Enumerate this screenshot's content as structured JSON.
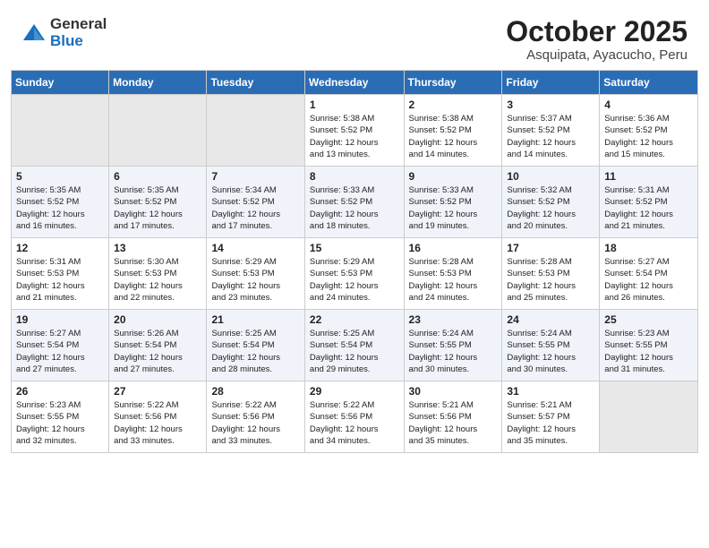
{
  "header": {
    "logo_general": "General",
    "logo_blue": "Blue",
    "month": "October 2025",
    "location": "Asquipata, Ayacucho, Peru"
  },
  "weekdays": [
    "Sunday",
    "Monday",
    "Tuesday",
    "Wednesday",
    "Thursday",
    "Friday",
    "Saturday"
  ],
  "weeks": [
    [
      {
        "day": "",
        "info": ""
      },
      {
        "day": "",
        "info": ""
      },
      {
        "day": "",
        "info": ""
      },
      {
        "day": "1",
        "info": "Sunrise: 5:38 AM\nSunset: 5:52 PM\nDaylight: 12 hours\nand 13 minutes."
      },
      {
        "day": "2",
        "info": "Sunrise: 5:38 AM\nSunset: 5:52 PM\nDaylight: 12 hours\nand 14 minutes."
      },
      {
        "day": "3",
        "info": "Sunrise: 5:37 AM\nSunset: 5:52 PM\nDaylight: 12 hours\nand 14 minutes."
      },
      {
        "day": "4",
        "info": "Sunrise: 5:36 AM\nSunset: 5:52 PM\nDaylight: 12 hours\nand 15 minutes."
      }
    ],
    [
      {
        "day": "5",
        "info": "Sunrise: 5:35 AM\nSunset: 5:52 PM\nDaylight: 12 hours\nand 16 minutes."
      },
      {
        "day": "6",
        "info": "Sunrise: 5:35 AM\nSunset: 5:52 PM\nDaylight: 12 hours\nand 17 minutes."
      },
      {
        "day": "7",
        "info": "Sunrise: 5:34 AM\nSunset: 5:52 PM\nDaylight: 12 hours\nand 17 minutes."
      },
      {
        "day": "8",
        "info": "Sunrise: 5:33 AM\nSunset: 5:52 PM\nDaylight: 12 hours\nand 18 minutes."
      },
      {
        "day": "9",
        "info": "Sunrise: 5:33 AM\nSunset: 5:52 PM\nDaylight: 12 hours\nand 19 minutes."
      },
      {
        "day": "10",
        "info": "Sunrise: 5:32 AM\nSunset: 5:52 PM\nDaylight: 12 hours\nand 20 minutes."
      },
      {
        "day": "11",
        "info": "Sunrise: 5:31 AM\nSunset: 5:52 PM\nDaylight: 12 hours\nand 21 minutes."
      }
    ],
    [
      {
        "day": "12",
        "info": "Sunrise: 5:31 AM\nSunset: 5:53 PM\nDaylight: 12 hours\nand 21 minutes."
      },
      {
        "day": "13",
        "info": "Sunrise: 5:30 AM\nSunset: 5:53 PM\nDaylight: 12 hours\nand 22 minutes."
      },
      {
        "day": "14",
        "info": "Sunrise: 5:29 AM\nSunset: 5:53 PM\nDaylight: 12 hours\nand 23 minutes."
      },
      {
        "day": "15",
        "info": "Sunrise: 5:29 AM\nSunset: 5:53 PM\nDaylight: 12 hours\nand 24 minutes."
      },
      {
        "day": "16",
        "info": "Sunrise: 5:28 AM\nSunset: 5:53 PM\nDaylight: 12 hours\nand 24 minutes."
      },
      {
        "day": "17",
        "info": "Sunrise: 5:28 AM\nSunset: 5:53 PM\nDaylight: 12 hours\nand 25 minutes."
      },
      {
        "day": "18",
        "info": "Sunrise: 5:27 AM\nSunset: 5:54 PM\nDaylight: 12 hours\nand 26 minutes."
      }
    ],
    [
      {
        "day": "19",
        "info": "Sunrise: 5:27 AM\nSunset: 5:54 PM\nDaylight: 12 hours\nand 27 minutes."
      },
      {
        "day": "20",
        "info": "Sunrise: 5:26 AM\nSunset: 5:54 PM\nDaylight: 12 hours\nand 27 minutes."
      },
      {
        "day": "21",
        "info": "Sunrise: 5:25 AM\nSunset: 5:54 PM\nDaylight: 12 hours\nand 28 minutes."
      },
      {
        "day": "22",
        "info": "Sunrise: 5:25 AM\nSunset: 5:54 PM\nDaylight: 12 hours\nand 29 minutes."
      },
      {
        "day": "23",
        "info": "Sunrise: 5:24 AM\nSunset: 5:55 PM\nDaylight: 12 hours\nand 30 minutes."
      },
      {
        "day": "24",
        "info": "Sunrise: 5:24 AM\nSunset: 5:55 PM\nDaylight: 12 hours\nand 30 minutes."
      },
      {
        "day": "25",
        "info": "Sunrise: 5:23 AM\nSunset: 5:55 PM\nDaylight: 12 hours\nand 31 minutes."
      }
    ],
    [
      {
        "day": "26",
        "info": "Sunrise: 5:23 AM\nSunset: 5:55 PM\nDaylight: 12 hours\nand 32 minutes."
      },
      {
        "day": "27",
        "info": "Sunrise: 5:22 AM\nSunset: 5:56 PM\nDaylight: 12 hours\nand 33 minutes."
      },
      {
        "day": "28",
        "info": "Sunrise: 5:22 AM\nSunset: 5:56 PM\nDaylight: 12 hours\nand 33 minutes."
      },
      {
        "day": "29",
        "info": "Sunrise: 5:22 AM\nSunset: 5:56 PM\nDaylight: 12 hours\nand 34 minutes."
      },
      {
        "day": "30",
        "info": "Sunrise: 5:21 AM\nSunset: 5:56 PM\nDaylight: 12 hours\nand 35 minutes."
      },
      {
        "day": "31",
        "info": "Sunrise: 5:21 AM\nSunset: 5:57 PM\nDaylight: 12 hours\nand 35 minutes."
      },
      {
        "day": "",
        "info": ""
      }
    ]
  ]
}
